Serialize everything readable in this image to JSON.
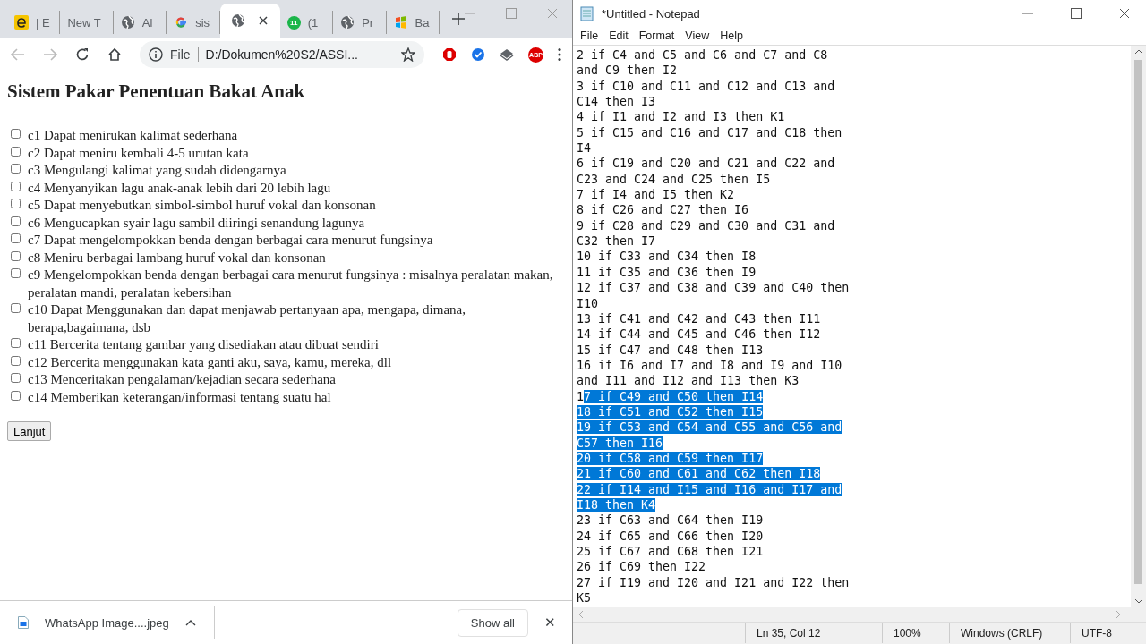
{
  "browser": {
    "tabs": [
      {
        "kind": "e",
        "title": "| E",
        "selected": false
      },
      {
        "kind": "blank",
        "title": "New T",
        "selected": false
      },
      {
        "kind": "globe",
        "title": "Al",
        "selected": false
      },
      {
        "kind": "google",
        "title": "sis",
        "selected": false
      },
      {
        "kind": "globe",
        "selected": true
      },
      {
        "kind": "chat",
        "badge": "11",
        "title": "(1",
        "selected": false
      },
      {
        "kind": "globe",
        "title": "Pr",
        "selected": false
      },
      {
        "kind": "windows",
        "title": "Ba",
        "selected": false
      }
    ],
    "address": {
      "scheme": "File",
      "url": "D:/Dokumen%20S2/ASSI..."
    },
    "extensions": [
      {
        "kind": "stop"
      },
      {
        "kind": "check"
      },
      {
        "kind": "layers"
      },
      {
        "kind": "abp",
        "label": "ABP"
      }
    ],
    "page": {
      "heading": "Sistem Pakar Penentuan Bakat Anak",
      "items": [
        {
          "label": "c1 Dapat menirukan kalimat sederhana",
          "checked": false
        },
        {
          "label": "c2 Dapat meniru kembali 4-5 urutan kata",
          "checked": false
        },
        {
          "label": "c3 Mengulangi kalimat yang sudah didengarnya",
          "checked": false
        },
        {
          "label": "c4 Menyanyikan lagu anak-anak lebih dari 20 lebih lagu",
          "checked": false
        },
        {
          "label": "c5 Dapat menyebutkan simbol-simbol huruf vokal dan konsonan",
          "checked": false
        },
        {
          "label": "c6 Mengucapkan syair lagu sambil diiringi senandung lagunya",
          "checked": false
        },
        {
          "label": "c7 Dapat mengelompokkan benda dengan berbagai cara menurut fungsinya",
          "checked": false
        },
        {
          "label": "c8 Meniru berbagai lambang huruf vokal dan konsonan",
          "checked": false
        },
        {
          "label": "c9 Mengelompokkan benda dengan berbagai cara menurut fungsinya : misalnya peralatan makan, peralatan mandi, peralatan kebersihan",
          "checked": false
        },
        {
          "label": "c10 Dapat Menggunakan dan dapat menjawab pertanyaan apa, mengapa, dimana, berapa,bagaimana, dsb",
          "checked": false
        },
        {
          "label": "c11 Bercerita tentang gambar yang disediakan atau dibuat sendiri",
          "checked": false
        },
        {
          "label": "c12 Bercerita menggunakan kata ganti aku, saya, kamu, mereka, dll",
          "checked": false
        },
        {
          "label": "c13 Menceritakan pengalaman/kejadian secara sederhana",
          "checked": false
        },
        {
          "label": "c14 Memberikan keterangan/informasi tentang suatu hal",
          "checked": false
        }
      ],
      "button": "Lanjut"
    },
    "download": {
      "file": "WhatsApp Image....jpeg",
      "show_all": "Show all",
      "close": "✕"
    }
  },
  "notepad": {
    "title": "*Untitled - Notepad",
    "menu": [
      "File",
      "Edit",
      "Format",
      "View",
      "Help"
    ],
    "lines": [
      {
        "text": "2 if C4 and C5 and C6 and C7 and C8",
        "selected": false
      },
      {
        "text": "and C9 then I2",
        "selected": false
      },
      {
        "text": "3 if C10 and C11 and C12 and C13 and",
        "selected": false
      },
      {
        "text": "C14 then I3",
        "selected": false
      },
      {
        "text": "4 if I1 and I2 and I3 then K1",
        "selected": false
      },
      {
        "text": "5 if C15 and C16 and C17 and C18 then",
        "selected": false
      },
      {
        "text": "I4",
        "selected": false
      },
      {
        "text": "6 if C19 and C20 and C21 and C22 and",
        "selected": false
      },
      {
        "text": "C23 and C24 and C25 then I5",
        "selected": false
      },
      {
        "text": "7 if I4 and I5 then K2",
        "selected": false
      },
      {
        "text": "8 if C26 and C27 then I6",
        "selected": false
      },
      {
        "text": "9 if C28 and C29 and C30 and C31 and",
        "selected": false
      },
      {
        "text": "C32 then I7",
        "selected": false
      },
      {
        "text": "10 if C33 and C34 then I8",
        "selected": false
      },
      {
        "text": "11 if C35 and C36 then I9",
        "selected": false
      },
      {
        "text": "12 if C37 and C38 and C39 and C40 then",
        "selected": false
      },
      {
        "text": "I10",
        "selected": false
      },
      {
        "text": "13 if C41 and C42 and C43 then I11",
        "selected": false
      },
      {
        "text": "14 if C44 and C45 and C46 then I12",
        "selected": false
      },
      {
        "text": "15 if C47 and C48 then I13",
        "selected": false
      },
      {
        "text": "16 if I6 and I7 and I8 and I9 and I10",
        "selected": false
      },
      {
        "text": "and I11 and I12 and I13 then K3",
        "selected": false
      },
      {
        "parts": [
          {
            "text": "1",
            "selected": false
          },
          {
            "text": "7 if C49 and C50 then I14",
            "selected": true
          }
        ]
      },
      {
        "text": "18 if C51 and C52 then I15",
        "selected": true
      },
      {
        "text": "19 if C53 and C54 and C55 and C56 and",
        "selected": true
      },
      {
        "text": "C57 then I16",
        "selected": true
      },
      {
        "text": "20 if C58 and C59 then I17",
        "selected": true
      },
      {
        "text": "21 if C60 and C61 and C62 then I18",
        "selected": true
      },
      {
        "text": "22 if I14 and I15 and I16 and I17 and",
        "selected": true
      },
      {
        "text": "I18 then K4",
        "selected": true
      },
      {
        "text": "23 if C63 and C64 then I19",
        "selected": false
      },
      {
        "text": "24 if C65 and C66 then I20",
        "selected": false
      },
      {
        "text": "25 if C67 and C68 then I21",
        "selected": false
      },
      {
        "text": "26 if C69 then I22",
        "selected": false
      },
      {
        "text": "27 if I19 and I20 and I21 and I22 then",
        "selected": false
      },
      {
        "text": "K5",
        "selected": false
      }
    ],
    "status": [
      "Ln 35, Col 12",
      "100%",
      "Windows (CRLF)",
      "UTF-8"
    ]
  }
}
